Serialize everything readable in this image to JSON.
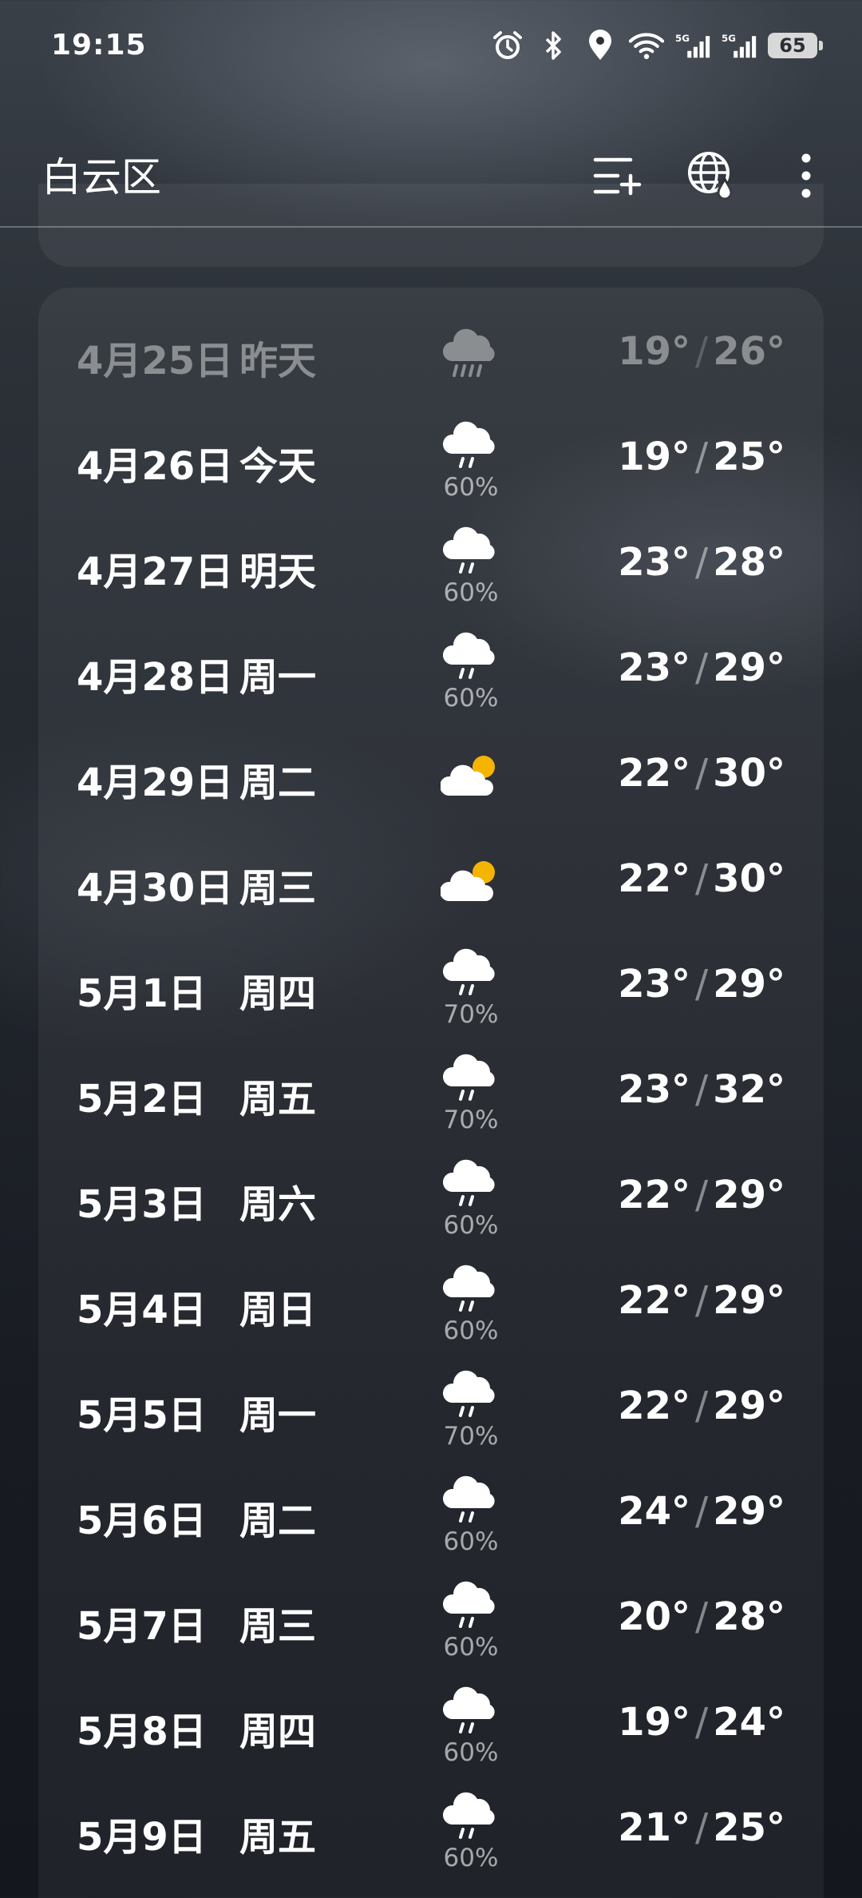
{
  "status_bar": {
    "time": "19:15",
    "battery": "65",
    "icons": [
      "alarm-icon",
      "bluetooth-icon",
      "location-icon",
      "wifi-icon",
      "5g-signal-icon",
      "5g-signal-icon",
      "battery-icon"
    ]
  },
  "header": {
    "title": "白云区",
    "actions": [
      "manage-cities-icon",
      "globe-rain-icon",
      "more-vertical-icon"
    ]
  },
  "forecast": [
    {
      "date": "4月25日",
      "day": "昨天",
      "icon": "rain-cloud-icon",
      "prob": "",
      "low": "19°",
      "high": "26°",
      "past": true
    },
    {
      "date": "4月26日",
      "day": "今天",
      "icon": "rain-cloud-icon",
      "prob": "60%",
      "low": "19°",
      "high": "25°"
    },
    {
      "date": "4月27日",
      "day": "明天",
      "icon": "rain-cloud-icon",
      "prob": "60%",
      "low": "23°",
      "high": "28°"
    },
    {
      "date": "4月28日",
      "day": "周一",
      "icon": "rain-cloud-icon",
      "prob": "60%",
      "low": "23°",
      "high": "29°"
    },
    {
      "date": "4月29日",
      "day": "周二",
      "icon": "partly-cloudy-icon",
      "prob": "",
      "low": "22°",
      "high": "30°"
    },
    {
      "date": "4月30日",
      "day": "周三",
      "icon": "partly-cloudy-icon",
      "prob": "",
      "low": "22°",
      "high": "30°"
    },
    {
      "date": "5月1日",
      "day": "周四",
      "icon": "rain-cloud-icon",
      "prob": "70%",
      "low": "23°",
      "high": "29°"
    },
    {
      "date": "5月2日",
      "day": "周五",
      "icon": "rain-cloud-icon",
      "prob": "70%",
      "low": "23°",
      "high": "32°"
    },
    {
      "date": "5月3日",
      "day": "周六",
      "icon": "rain-cloud-icon",
      "prob": "60%",
      "low": "22°",
      "high": "29°"
    },
    {
      "date": "5月4日",
      "day": "周日",
      "icon": "rain-cloud-icon",
      "prob": "60%",
      "low": "22°",
      "high": "29°"
    },
    {
      "date": "5月5日",
      "day": "周一",
      "icon": "rain-cloud-icon",
      "prob": "70%",
      "low": "22°",
      "high": "29°"
    },
    {
      "date": "5月6日",
      "day": "周二",
      "icon": "rain-cloud-icon",
      "prob": "60%",
      "low": "24°",
      "high": "29°"
    },
    {
      "date": "5月7日",
      "day": "周三",
      "icon": "rain-cloud-icon",
      "prob": "60%",
      "low": "20°",
      "high": "28°"
    },
    {
      "date": "5月8日",
      "day": "周四",
      "icon": "rain-cloud-icon",
      "prob": "60%",
      "low": "19°",
      "high": "24°"
    },
    {
      "date": "5月9日",
      "day": "周五",
      "icon": "rain-cloud-icon",
      "prob": "60%",
      "low": "21°",
      "high": "25°"
    }
  ],
  "colors": {
    "sun": "#f5b400",
    "cloud": "#ffffff",
    "text": "#ffffff"
  }
}
